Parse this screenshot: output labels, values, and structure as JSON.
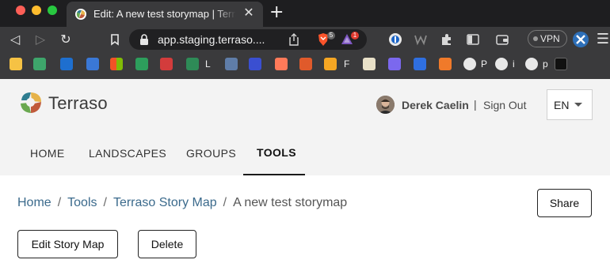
{
  "browser": {
    "tab_title": "Edit: A new test storymap | Terraso",
    "url": "app.staging.terraso....",
    "brave_shield_count": "5",
    "rewards_count": "1",
    "vpn_label": "VPN",
    "bookmarks": [
      {
        "label": "L"
      },
      {
        "label": "F"
      },
      {
        "label": "P"
      },
      {
        "label": "i"
      },
      {
        "label": "p"
      }
    ]
  },
  "site": {
    "logo_text": "Terraso",
    "user_name": "Derek Caelin",
    "separator": "|",
    "sign_out": "Sign Out",
    "language": "EN",
    "nav": [
      {
        "label": "HOME"
      },
      {
        "label": "LANDSCAPES"
      },
      {
        "label": "GROUPS"
      },
      {
        "label": "TOOLS"
      }
    ],
    "active_nav": "TOOLS"
  },
  "breadcrumb": {
    "items": [
      "Home",
      "Tools",
      "Terraso Story Map"
    ],
    "separator": "/",
    "current": "A new test storymap"
  },
  "actions": {
    "share": "Share",
    "edit": "Edit Story Map",
    "delete": "Delete"
  }
}
